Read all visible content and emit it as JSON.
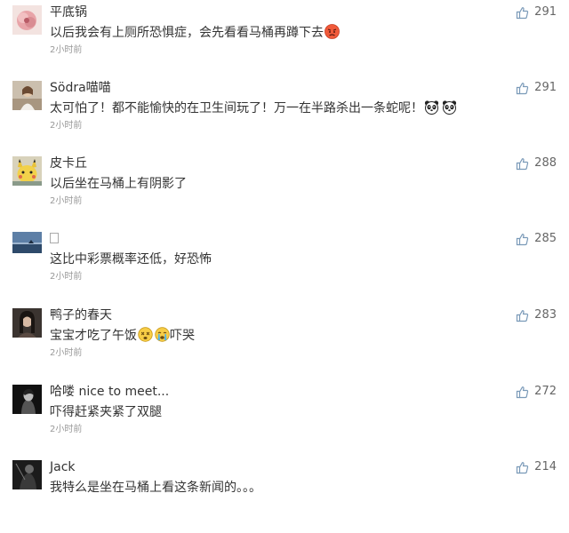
{
  "comments": [
    {
      "username": "平底锅",
      "text": "以后我会有上厕所恐惧症，会先看看马桶再蹲下去",
      "emojis": [
        "angry-face-emoji"
      ],
      "time": "2小时前",
      "likes": "291",
      "avatar": "pink-flower-avatar"
    },
    {
      "username": "Södra喵喵",
      "text": "太可怕了！都不能愉快的在卫生间玩了！万一在半路杀出一条蛇呢！",
      "emojis": [
        "panda-emoji",
        "panda-emoji"
      ],
      "time": "2小时前",
      "likes": "291",
      "avatar": "girl-photo-avatar"
    },
    {
      "username": "皮卡丘",
      "text": "以后坐在马桶上有阴影了",
      "emojis": [],
      "time": "2小时前",
      "likes": "288",
      "avatar": "pikachu-avatar"
    },
    {
      "username": "",
      "text": "这比中彩票概率还低，好恐怖",
      "emojis": [],
      "time": "2小时前",
      "likes": "285",
      "avatar": "seascape-avatar"
    },
    {
      "username": "鸭子的春天",
      "text": "宝宝才吃了午饭",
      "text_after": "吓哭",
      "emojis": [
        "dizzy-face-emoji",
        "crying-face-emoji"
      ],
      "time": "2小时前",
      "likes": "283",
      "avatar": "dark-portrait-avatar"
    },
    {
      "username": "哈喽 nice to meet...",
      "text": "吓得赶紧夹紧了双腿",
      "emojis": [],
      "time": "2小时前",
      "likes": "272",
      "avatar": "bw-portrait-avatar"
    },
    {
      "username": "Jack",
      "text": "我特么是坐在马桶上看这条新闻的。。。",
      "emojis": [],
      "time": "",
      "likes": "214",
      "avatar": "dark-figure-avatar"
    }
  ],
  "colors": {
    "text": "#333333",
    "meta": "#999999",
    "like_icon": "#7a9ab8"
  },
  "icons": {
    "like": "thumbs-up-icon"
  }
}
